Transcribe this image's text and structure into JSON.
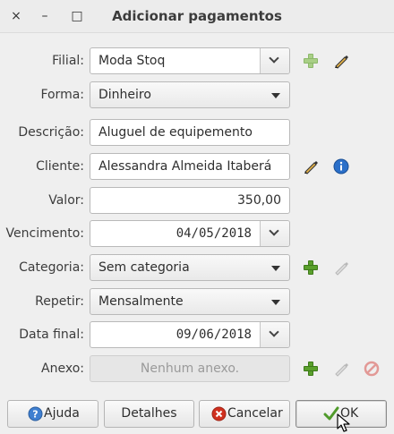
{
  "window": {
    "title": "Adicionar pagamentos",
    "close_glyph": "×",
    "minimize_glyph": "–",
    "maximize_glyph": "□"
  },
  "form": {
    "filial": {
      "label": "Filial:",
      "value": "Moda Stoq"
    },
    "forma": {
      "label": "Forma:",
      "value": "Dinheiro"
    },
    "descricao": {
      "label": "Descrição:",
      "value": "Aluguel de equipemento"
    },
    "cliente": {
      "label": "Cliente:",
      "value": "Alessandra Almeida Itaberá"
    },
    "valor": {
      "label": "Valor:",
      "value": "350,00"
    },
    "vencimento": {
      "label": "Vencimento:",
      "value": "04/05/2018"
    },
    "categoria": {
      "label": "Categoria:",
      "value": "Sem categoria"
    },
    "repetir": {
      "label": "Repetir:",
      "value": "Mensalmente"
    },
    "data_final": {
      "label": "Data final:",
      "value": "09/06/2018"
    },
    "anexo": {
      "label": "Anexo:",
      "value": "Nenhum anexo."
    }
  },
  "buttons": {
    "help": "Ajuda",
    "details": "Detalhes",
    "cancel": "Cancelar",
    "ok": "OK"
  },
  "colors": {
    "add_green": "#5aa02c",
    "info_blue": "#2a6fc9",
    "cancel_red": "#d0301f",
    "remove_red": "#d9534f"
  }
}
